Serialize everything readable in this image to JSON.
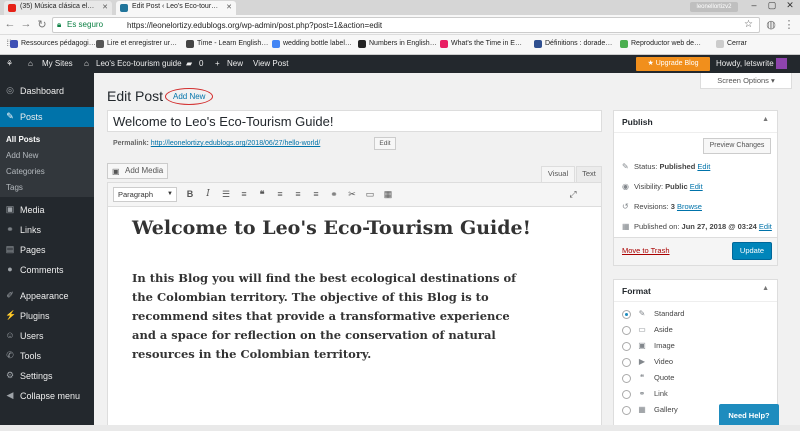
{
  "browser": {
    "tabs": [
      {
        "title": "(35) Música clásica el…",
        "favicon_color": "#e62117",
        "active": false
      },
      {
        "title": "Edit Post ‹ Leo's Eco-tour…",
        "favicon_color": "#21759b",
        "active": true
      }
    ],
    "window_user": "leonellortizv2",
    "security_label": "Es seguro",
    "url": "https://leonelortizy.edublogs.org/wp-admin/post.php?post=1&action=edit",
    "bookmarks": [
      {
        "label": "Ressources pédagogi…",
        "color": "#3f51b5"
      },
      {
        "label": "Lire et enregistrer ur…",
        "color": "#555555"
      },
      {
        "label": "Time - Learn English…",
        "color": "#444444"
      },
      {
        "label": "wedding bottle label…",
        "color": "#4285f4"
      },
      {
        "label": "Numbers in English…",
        "color": "#222222"
      },
      {
        "label": "What's the Time in E…",
        "color": "#e91e63"
      },
      {
        "label": "Définitions : dorade…",
        "color": "#2f4f8f"
      },
      {
        "label": "Reproductor web de…",
        "color": "#4caf50"
      },
      {
        "label": "Cerrar",
        "color": "#cccccc"
      }
    ]
  },
  "adminbar": {
    "my_sites": "My Sites",
    "site_name": "Leo's Eco-tourism guide",
    "comments_count": "0",
    "new_label": "New",
    "view_post": "View Post",
    "upgrade": "Upgrade Blog",
    "howdy": "Howdy, letswrite"
  },
  "sidebar": {
    "items": [
      {
        "label": "Dashboard",
        "icon": "dashboard-icon",
        "glyph": "◎"
      },
      {
        "label": "Posts",
        "icon": "pin-icon",
        "glyph": "✎"
      },
      {
        "label": "Media",
        "icon": "media-icon",
        "glyph": "▣"
      },
      {
        "label": "Links",
        "icon": "link-icon",
        "glyph": "⚭"
      },
      {
        "label": "Pages",
        "icon": "page-icon",
        "glyph": "▤"
      },
      {
        "label": "Comments",
        "icon": "comment-icon",
        "glyph": "●"
      },
      {
        "label": "Appearance",
        "icon": "brush-icon",
        "glyph": "✐"
      },
      {
        "label": "Plugins",
        "icon": "plugin-icon",
        "glyph": "⚡"
      },
      {
        "label": "Users",
        "icon": "users-icon",
        "glyph": "☺"
      },
      {
        "label": "Tools",
        "icon": "tools-icon",
        "glyph": "✆"
      },
      {
        "label": "Settings",
        "icon": "settings-icon",
        "glyph": "⚙"
      },
      {
        "label": "Collapse menu",
        "icon": "collapse-icon",
        "glyph": "◀"
      }
    ],
    "sub_items": [
      "All Posts",
      "Add New",
      "Categories",
      "Tags"
    ]
  },
  "main": {
    "heading": "Edit Post",
    "add_new": "Add New",
    "screen_options": "Screen Options ▾",
    "post_title": "Welcome to Leo's Eco-Tourism Guide!",
    "permalink_label": "Permalink:",
    "permalink_url": "http://leonelortizy.edublogs.org/2018/06/27/hello-world/",
    "permalink_edit": "Edit",
    "add_media": "Add Media",
    "tab_visual": "Visual",
    "tab_text": "Text",
    "format_select": "Paragraph",
    "content_heading": "Welcome to Leo's Eco-Tourism Guide!",
    "content_paragraph": "In this Blog you will find the best ecological destinations of the Colombian territory. The objective of this Blog is to recommend sites that provide a transformative experience and a space for reflection on the conservation of natural resources in the Colombian territory."
  },
  "publish": {
    "title": "Publish",
    "preview": "Preview Changes",
    "status_label": "Status:",
    "status_value": "Published",
    "visibility_label": "Visibility:",
    "visibility_value": "Public",
    "revisions_label": "Revisions:",
    "revisions_value": "3",
    "browse": "Browse",
    "published_on_label": "Published on:",
    "published_on_value": "Jun 27, 2018 @ 03:24",
    "edit": "Edit",
    "trash": "Move to Trash",
    "update": "Update"
  },
  "format": {
    "title": "Format",
    "options": [
      {
        "label": "Standard",
        "icon": "pin-icon",
        "glyph": "✎",
        "selected": true
      },
      {
        "label": "Aside",
        "icon": "aside-icon",
        "glyph": "▭",
        "selected": false
      },
      {
        "label": "Image",
        "icon": "image-icon",
        "glyph": "▣",
        "selected": false
      },
      {
        "label": "Video",
        "icon": "video-icon",
        "glyph": "▶",
        "selected": false
      },
      {
        "label": "Quote",
        "icon": "quote-icon",
        "glyph": "❝",
        "selected": false
      },
      {
        "label": "Link",
        "icon": "link-icon",
        "glyph": "⚭",
        "selected": false
      },
      {
        "label": "Gallery",
        "icon": "gallery-icon",
        "glyph": "▦",
        "selected": false
      }
    ]
  },
  "help": "Need Help?"
}
